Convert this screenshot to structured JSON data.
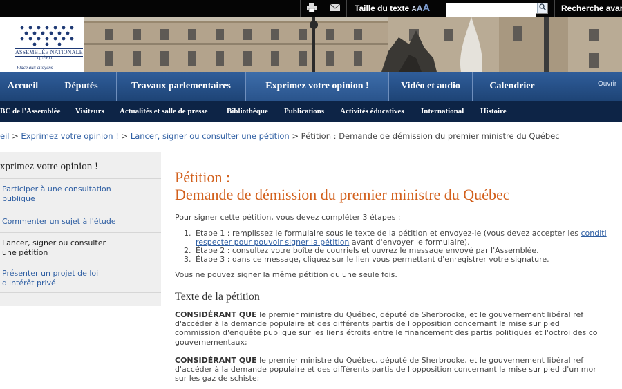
{
  "topbar": {
    "print_icon": "printer-icon",
    "email_icon": "envelope-icon",
    "text_size_label": "Taille du texte",
    "text_size_a1": "A",
    "text_size_a2": "A",
    "text_size_a3": "A",
    "search_value": "",
    "search_icon": "magnifier-icon",
    "advanced_search": "Recherche avar"
  },
  "banner": {
    "logo_name": "ASSEMBLÉE NATIONALE",
    "logo_sub": "QUÉBEC",
    "logo_tagline": "Place aux citoyens"
  },
  "main_nav": {
    "items": [
      "Accueil",
      "Députés",
      "Travaux parlementaires",
      "Exprimez votre opinion !",
      "Vidéo et audio",
      "Calendrier"
    ],
    "open_label": "Ouvrir"
  },
  "sub_nav": {
    "items": [
      "BC de l'Assemblée",
      "Visiteurs",
      "Actualités et salle de presse",
      "Bibliothèque",
      "Publications",
      "Activités éducatives",
      "International",
      "Histoire"
    ]
  },
  "breadcrumb": {
    "items": [
      "eil",
      "Exprimez votre opinion !",
      "Lancer, signer ou consulter une pétition"
    ],
    "separator": ">",
    "current": "Pétition : Demande de démission du premier ministre du Québec"
  },
  "sidebar": {
    "title": "xprimez votre opinion !",
    "items": [
      {
        "label": "Participer à une consultation publique",
        "lines": [
          "Participer à une consultation",
          "publique"
        ]
      },
      {
        "label": "Commenter un sujet à l'étude",
        "lines": [
          "Commenter un sujet à l'étude"
        ]
      },
      {
        "label": "Lancer, signer ou consulter une pétition",
        "lines": [
          "Lancer, signer ou consulter",
          "une pétition"
        ]
      },
      {
        "label": "Présenter un projet de loi d'intérêt privé",
        "lines": [
          "Présenter un projet de loi",
          "d'intérêt privé"
        ]
      }
    ]
  },
  "content": {
    "title_line1": "Pétition :",
    "title_line2": "Demande de démission du premier ministre du Québec",
    "intro": "Pour signer cette pétition, vous devez compléter 3 étapes :",
    "step1_num": "1.",
    "step1_text": "Étape 1 : remplissez le formulaire sous le texte de la pétition et envoyez-le (vous devez accepter les ",
    "step1_link": "conditi",
    "step1_link2": "respecter pour pouvoir signer la pétition",
    "step1_tail": " avant d'envoyer le formulaire).",
    "step2_num": "2.",
    "step2_text": "Étape 2 : consultez votre boîte de courriels et ouvrez le message envoyé par l'Assemblée.",
    "step3_num": "3.",
    "step3_text": "Étape 3 : dans ce message, cliquez sur le lien vous permettant d'enregistrer votre signature.",
    "once": "Vous ne pouvez signer la même pétition qu'une seule fois.",
    "section_title": "Texte de la pétition",
    "considerant": "CONSIDÉRANT QUE",
    "para1": {
      "line1": " le premier ministre du Québec, député de Sherbrooke, et le gouvernement libéral ref",
      "line2": "d'accéder à la demande populaire et des différents partis de l'opposition concernant la mise sur pied",
      "line3": "commission d'enquête publique sur les liens étroits entre le financement des partis politiques et l'octroi des co",
      "line4": "gouvernementaux;"
    },
    "para2": {
      "line1": " le premier ministre du Québec, député de Sherbrooke, et le gouvernement libéral ref",
      "line2": "d'accéder à la demande populaire et des différents partis de l'opposition concernant la mise sur pied d'un mor",
      "line3": "sur les gaz de schiste;"
    }
  }
}
